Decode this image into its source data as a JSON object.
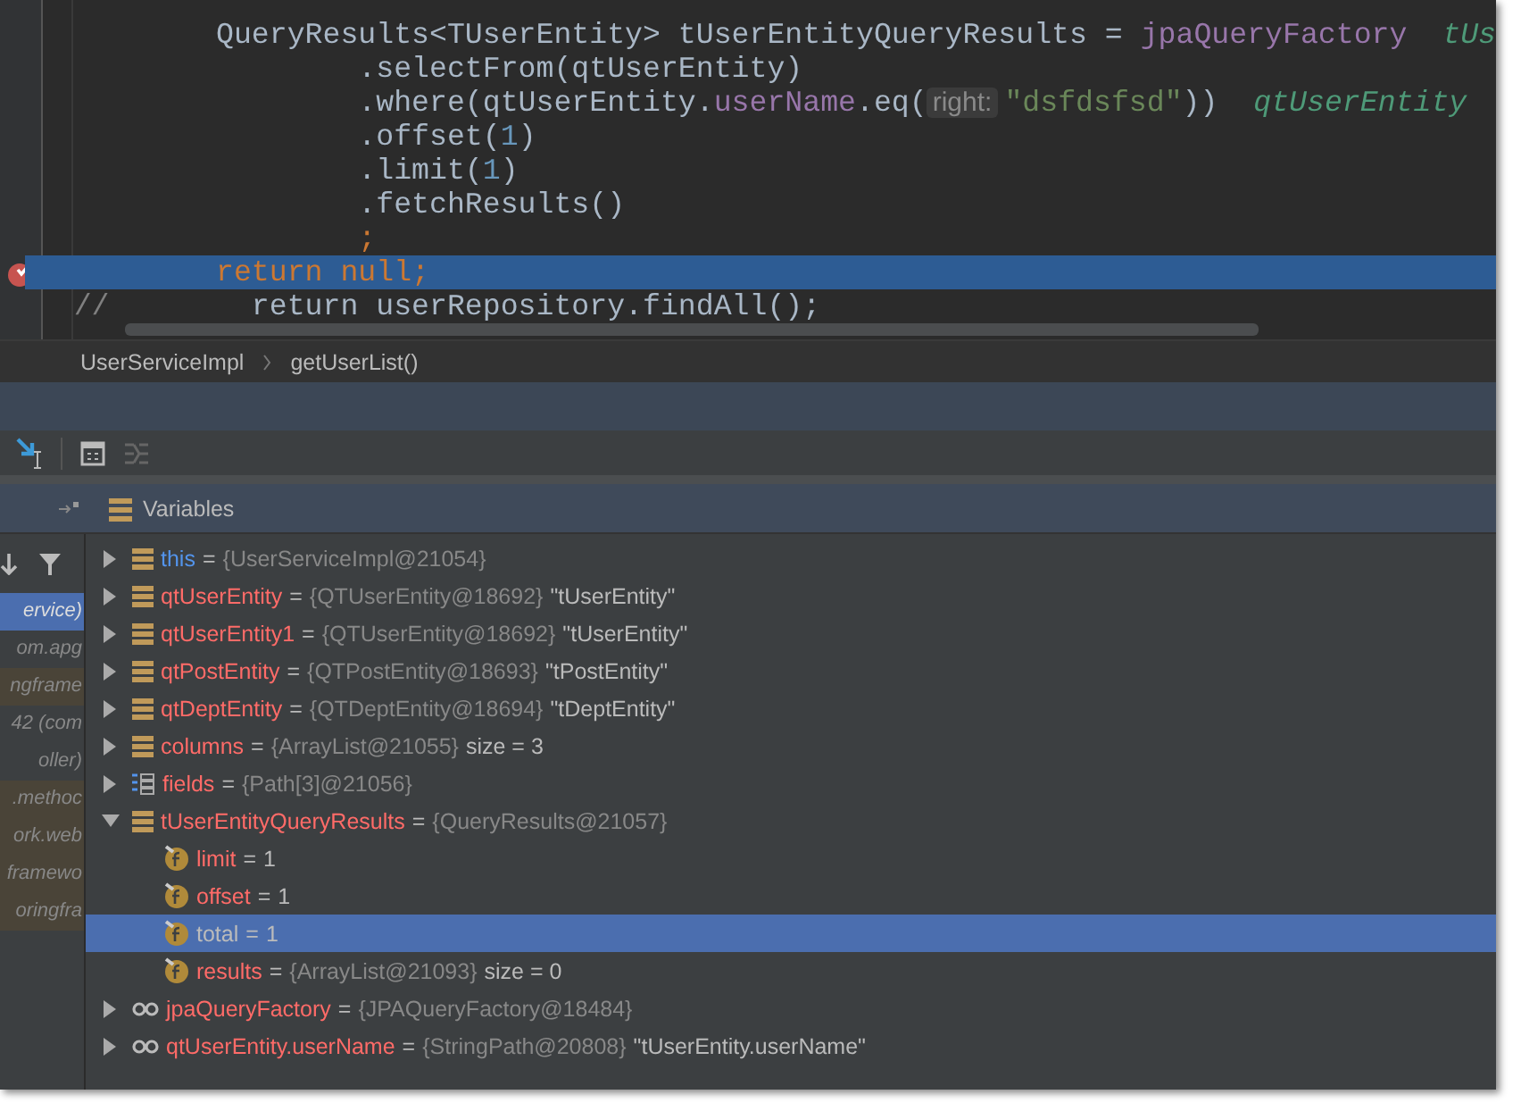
{
  "editor": {
    "lines": [
      {
        "selected": false,
        "breakpoint": false,
        "tokens": [
          {
            "kind": "plain",
            "text": "        QueryResults<TUserEntity> tUserEntityQueryResults = "
          },
          {
            "kind": "field",
            "text": "jpaQueryFactory"
          },
          {
            "kind": "inline",
            "text": "  tUs"
          }
        ]
      },
      {
        "selected": false,
        "breakpoint": false,
        "tokens": [
          {
            "kind": "plain",
            "text": "                .selectFrom(qtUserEntity)"
          }
        ]
      },
      {
        "selected": false,
        "breakpoint": false,
        "tokens": [
          {
            "kind": "plain",
            "text": "                .where(qtUserEntity."
          },
          {
            "kind": "field",
            "text": "userName"
          },
          {
            "kind": "plain",
            "text": ".eq("
          },
          {
            "kind": "hint",
            "text": "right:"
          },
          {
            "kind": "string",
            "text": "\"dsfdsfsd\""
          },
          {
            "kind": "plain",
            "text": "))"
          },
          {
            "kind": "inline",
            "text": "  qtUserEntity"
          }
        ]
      },
      {
        "selected": false,
        "breakpoint": false,
        "tokens": [
          {
            "kind": "plain",
            "text": "                .offset("
          },
          {
            "kind": "number",
            "text": "1"
          },
          {
            "kind": "plain",
            "text": ")"
          }
        ]
      },
      {
        "selected": false,
        "breakpoint": false,
        "tokens": [
          {
            "kind": "plain",
            "text": "                .limit("
          },
          {
            "kind": "number",
            "text": "1"
          },
          {
            "kind": "plain",
            "text": ")"
          }
        ]
      },
      {
        "selected": false,
        "breakpoint": false,
        "tokens": [
          {
            "kind": "plain",
            "text": "                .fetchResults()"
          }
        ]
      },
      {
        "selected": false,
        "breakpoint": false,
        "tokens": [
          {
            "kind": "keyword",
            "text": "                ;"
          }
        ]
      },
      {
        "selected": true,
        "breakpoint": true,
        "tokens": [
          {
            "kind": "keyword",
            "text": "        return null;"
          }
        ]
      },
      {
        "selected": false,
        "breakpoint": false,
        "tokens": [
          {
            "kind": "comment",
            "text": "//  "
          },
          {
            "kind": "plain",
            "text": "      return userRepository.findAll();"
          }
        ]
      }
    ]
  },
  "breadcrumb": [
    "UserServiceImpl",
    "getUserList()"
  ],
  "variables_panel": {
    "title": "Variables"
  },
  "frames": [
    {
      "text": "ervice)",
      "selected": true,
      "kind": "app"
    },
    {
      "text": "om.apg",
      "selected": false,
      "kind": "app"
    },
    {
      "text": "ngframe",
      "selected": false,
      "kind": "library"
    },
    {
      "text": "42 *(com*",
      "selected": false,
      "kind": "app"
    },
    {
      "text": "oller)",
      "selected": false,
      "kind": "app"
    },
    {
      "text": ".methoc",
      "selected": false,
      "kind": "library"
    },
    {
      "text": "ork.web",
      "selected": false,
      "kind": "library"
    },
    {
      "text": "framewo",
      "selected": false,
      "kind": "library"
    },
    {
      "text": "oringfra",
      "selected": false,
      "kind": "library"
    }
  ],
  "variables": [
    {
      "kind": "object",
      "name": "this",
      "color": "#5394ec",
      "sign": "=",
      "value": "{UserServiceImpl@21054}",
      "expanded": false,
      "selected": false
    },
    {
      "kind": "object",
      "name": "qtUserEntity",
      "color": "#ff6b68",
      "sign": "=",
      "value": "{QTUserEntity@18692}",
      "extra": "\"tUserEntity\"",
      "expanded": false,
      "selected": false
    },
    {
      "kind": "object",
      "name": "qtUserEntity1",
      "color": "#ff6b68",
      "sign": "=",
      "value": "{QTUserEntity@18692}",
      "extra": "\"tUserEntity\"",
      "expanded": false,
      "selected": false
    },
    {
      "kind": "object",
      "name": "qtPostEntity",
      "color": "#ff6b68",
      "sign": "=",
      "value": "{QTPostEntity@18693}",
      "extra": "\"tPostEntity\"",
      "expanded": false,
      "selected": false
    },
    {
      "kind": "object",
      "name": "qtDeptEntity",
      "color": "#ff6b68",
      "sign": "=",
      "value": "{QTDeptEntity@18694}",
      "extra": "\"tDeptEntity\"",
      "expanded": false,
      "selected": false
    },
    {
      "kind": "object",
      "name": "columns",
      "color": "#ff6b68",
      "sign": "=",
      "value": "{ArrayList@21055}",
      "extra": "size = 3",
      "expanded": false,
      "selected": false
    },
    {
      "kind": "array",
      "name": "fields",
      "color": "#ff6b68",
      "sign": "=",
      "value": "{Path[3]@21056}",
      "expanded": false,
      "selected": false
    },
    {
      "kind": "object",
      "name": "tUserEntityQueryResults",
      "color": "#ff6b68",
      "sign": "=",
      "value": "{QueryResults@21057}",
      "expanded": true,
      "selected": false,
      "children": [
        {
          "kind": "field",
          "name": "limit",
          "color": "#ff6b68",
          "sign": "=",
          "extra": "1",
          "selected": false
        },
        {
          "kind": "field",
          "name": "offset",
          "color": "#ff6b68",
          "sign": "=",
          "extra": "1",
          "selected": false
        },
        {
          "kind": "field",
          "name": "total",
          "color": "#bbbbbb",
          "sign": "=",
          "extra": "1",
          "selected": true
        },
        {
          "kind": "field",
          "name": "results",
          "color": "#ff6b68",
          "sign": "=",
          "value": "{ArrayList@21093}",
          "extra": "size = 0",
          "selected": false
        }
      ]
    },
    {
      "kind": "watch",
      "name": "jpaQueryFactory",
      "color": "#ff6b68",
      "sign": "=",
      "value": "{JPAQueryFactory@18484}",
      "expanded": false,
      "selected": false
    },
    {
      "kind": "watch",
      "name": "qtUserEntity.userName",
      "color": "#ff6b68",
      "sign": "=",
      "value": "{StringPath@20808}",
      "extra": "\"tUserEntity.userName\"",
      "expanded": false,
      "selected": false
    }
  ]
}
